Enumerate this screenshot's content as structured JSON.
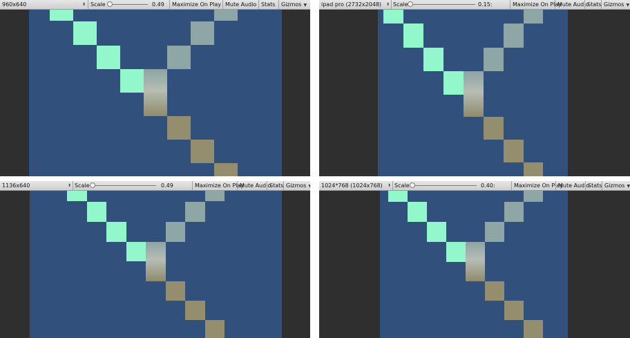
{
  "panels": [
    {
      "resolution": "960x640",
      "scale_label": "Scale",
      "scale_value": "0.49",
      "maximize_label": "Maximize On Play",
      "mute_label": "Mute Audio",
      "stats_label": "Stats",
      "gizmos_label": "Gizmos"
    },
    {
      "resolution": "ipad pro (2732x2048)",
      "scale_label": "Scale",
      "scale_value": "0.15:",
      "maximize_label": "Maximize On Play",
      "mute_label": "Mute Audio",
      "stats_label": "Stats",
      "gizmos_label": "Gizmos"
    },
    {
      "resolution": "1136x640",
      "scale_label": "Scale",
      "scale_value": "0.49",
      "maximize_label": "Maximize On Play",
      "mute_label": "Mute Audio",
      "stats_label": "Stats",
      "gizmos_label": "Gizmos"
    },
    {
      "resolution": "1024*768 (1024x768)",
      "scale_label": "Scale",
      "scale_value": "0.40:",
      "maximize_label": "Maximize On Play",
      "mute_label": "Mute Audio",
      "stats_label": "Stats",
      "gizmos_label": "Gizmos"
    }
  ],
  "colors": {
    "game_background": "#31507c",
    "letterbox": "#2f2f2f",
    "tile_teal": "#93f7cc",
    "tile_grey": "#8ea6a6",
    "tile_tan": "#958e6e"
  },
  "icons": {
    "dropdown": "updown-arrows-icon",
    "slider": "slider-thumb-icon",
    "menu": "caret-down-icon"
  }
}
